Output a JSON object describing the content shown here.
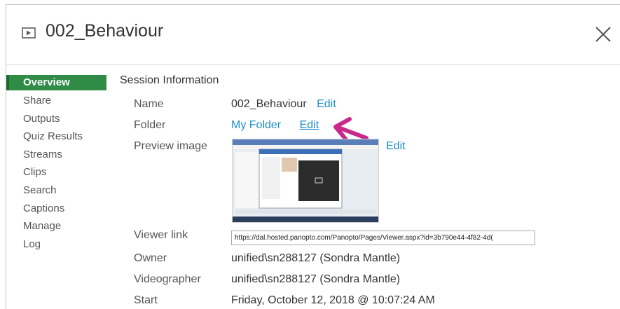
{
  "header": {
    "title": "002_Behaviour"
  },
  "sidebar": {
    "items": [
      {
        "label": "Overview"
      },
      {
        "label": "Share"
      },
      {
        "label": "Outputs"
      },
      {
        "label": "Quiz Results"
      },
      {
        "label": "Streams"
      },
      {
        "label": "Clips"
      },
      {
        "label": "Search"
      },
      {
        "label": "Captions"
      },
      {
        "label": "Manage"
      },
      {
        "label": "Log"
      }
    ]
  },
  "main": {
    "section_title": "Session Information",
    "name": {
      "label": "Name",
      "value": "002_Behaviour",
      "edit": "Edit"
    },
    "folder": {
      "label": "Folder",
      "value": "My Folder",
      "edit": "Edit"
    },
    "preview": {
      "label": "Preview image",
      "edit": "Edit"
    },
    "viewer_link": {
      "label": "Viewer link",
      "value": "https://dal.hosted.panopto.com/Panopto/Pages/Viewer.aspx?id=3b790e44-4f82-4d("
    },
    "owner": {
      "label": "Owner",
      "value": "unified\\sn288127 (Sondra Mantle)"
    },
    "videographer": {
      "label": "Videographer",
      "value": "unified\\sn288127 (Sondra Mantle)"
    },
    "start": {
      "label": "Start",
      "value": "Friday, October 12, 2018 @ 10:07:24 AM"
    }
  },
  "colors": {
    "accent": "#2f8b46",
    "link": "#1f8dcb",
    "arrow": "#c7298c"
  }
}
